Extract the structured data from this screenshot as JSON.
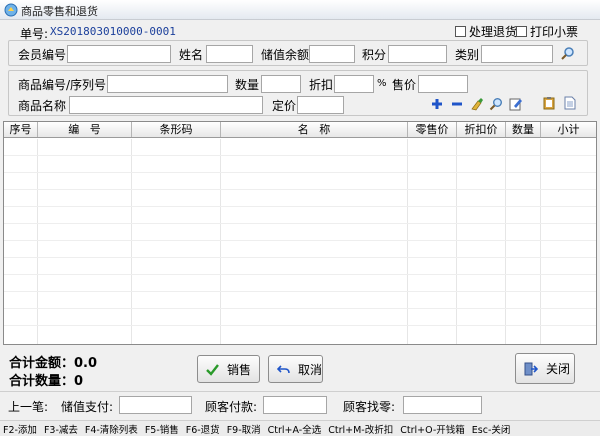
{
  "window": {
    "title": "商品零售和退货"
  },
  "order": {
    "label": "单号:",
    "number": "XS201803010000-0001"
  },
  "options": {
    "return_label": "处理退货",
    "print_label": "打印小票"
  },
  "member": {
    "id_label": "会员编号",
    "name_label": "姓名",
    "balance_label": "储值余额",
    "points_label": "积分",
    "type_label": "类别"
  },
  "product": {
    "code_label": "商品编号/序列号",
    "qty_label": "数量",
    "discount_label": "折扣",
    "percent": "%",
    "price_label": "售价",
    "name_label": "商品名称",
    "fixed_price_label": "定价"
  },
  "table": {
    "columns": [
      "序号",
      "编   号",
      "条形码",
      "名   称",
      "零售价",
      "折扣价",
      "数量",
      "小计"
    ]
  },
  "totals": {
    "amount": "合计金额：0.0",
    "quantity": "合计数量：0"
  },
  "buttons": {
    "sell": "销售",
    "cancel": "取消",
    "close": "关闭"
  },
  "footer": {
    "last_label": "上一笔:",
    "stored_pay_label": "储值支付:",
    "customer_paid_label": "顾客付款:",
    "change_label": "顾客找零:"
  },
  "shortcuts": [
    "F2-添加",
    "F3-减去",
    "F4-清除列表",
    "F5-销售",
    "F6-退货",
    "F9-取消",
    "Ctrl+A-全选",
    "Ctrl+M-改折扣",
    "Ctrl+O-开钱箱",
    "Esc-关闭"
  ],
  "colors": {
    "accent": "#1b3f9b",
    "ok_green": "#2a9a2a"
  }
}
